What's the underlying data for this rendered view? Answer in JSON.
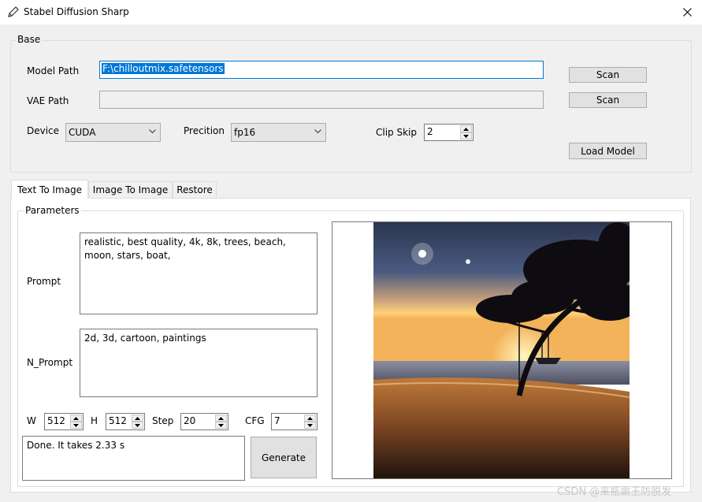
{
  "window": {
    "title": "Stabel Diffusion Sharp",
    "icon": "pencil-icon",
    "close_icon": "close-icon"
  },
  "base": {
    "group_label": "Base",
    "model_path_label": "Model Path",
    "model_path_value": "F:\\chilloutmix.safetensors",
    "vae_path_label": "VAE Path",
    "vae_path_value": "",
    "scan_label": "Scan",
    "scan_vae_label": "Scan",
    "device_label": "Device",
    "device_value": "CUDA",
    "precision_label": "Precition",
    "precision_value": "fp16",
    "clip_skip_label": "Clip Skip",
    "clip_skip_value": "2",
    "load_model_label": "Load Model"
  },
  "tabs": [
    {
      "label": "Text To Image",
      "active": true
    },
    {
      "label": "Image To Image",
      "active": false
    },
    {
      "label": "Restore",
      "active": false
    }
  ],
  "parameters": {
    "group_label": "Parameters",
    "prompt_label": "Prompt",
    "prompt_value": "realistic, best quality, 4k, 8k, trees, beach, moon, stars, boat,",
    "n_prompt_label": "N_Prompt",
    "n_prompt_value": "2d, 3d, cartoon, paintings",
    "w_label": "W",
    "w_value": "512",
    "h_label": "H",
    "h_value": "512",
    "step_label": "Step",
    "step_value": "20",
    "cfg_label": "CFG",
    "cfg_value": "7",
    "status_text": "Done. It takes 2.33 s",
    "generate_label": "Generate"
  },
  "output_image": {
    "subject": "generated-beach-sunset-image"
  },
  "watermark": "CSDN @来瓶霸王防脱发",
  "colors": {
    "selection": "#0078d7",
    "window_bg": "#f0f0f0"
  }
}
